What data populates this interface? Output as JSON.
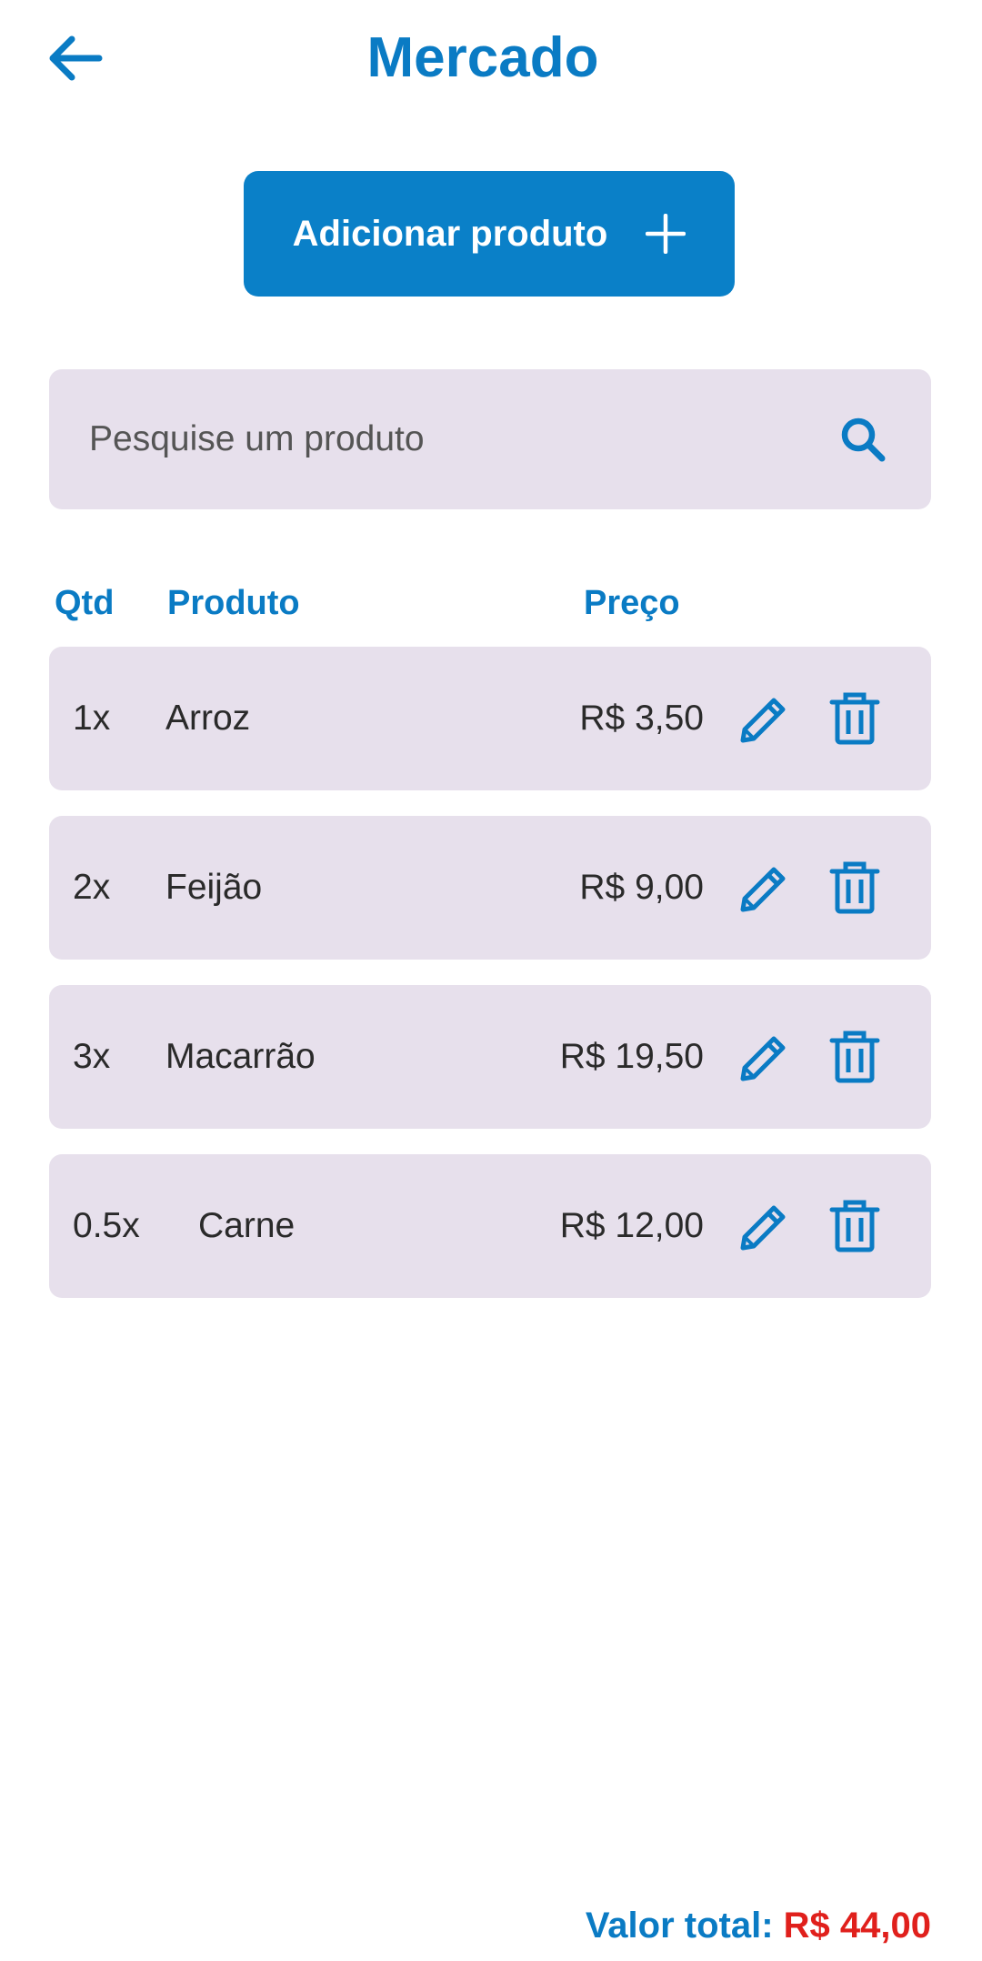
{
  "header": {
    "title": "Mercado",
    "back_icon": "arrow-left-icon"
  },
  "add_button": {
    "label": "Adicionar produto",
    "icon": "plus-icon"
  },
  "search": {
    "placeholder": "Pesquise um produto",
    "value": "",
    "icon": "search-icon"
  },
  "table": {
    "headers": {
      "qty": "Qtd",
      "product": "Produto",
      "price": "Preço"
    },
    "rows": [
      {
        "qty": "1x",
        "name": "Arroz",
        "price": "R$ 3,50"
      },
      {
        "qty": "2x",
        "name": "Feijão",
        "price": "R$ 9,00"
      },
      {
        "qty": "3x",
        "name": "Macarrão",
        "price": "R$ 19,50"
      },
      {
        "qty": "0.5x",
        "name": "Carne",
        "price": "R$ 12,00"
      }
    ],
    "row_icons": [
      "pencil-icon",
      "trash-icon"
    ]
  },
  "total": {
    "label": "Valor total:",
    "value": "R$ 44,00"
  },
  "colors": {
    "accent": "#0a7bc4",
    "button": "#0a80c8",
    "surface": "#e7e0ec",
    "total_value": "#e0201c"
  }
}
